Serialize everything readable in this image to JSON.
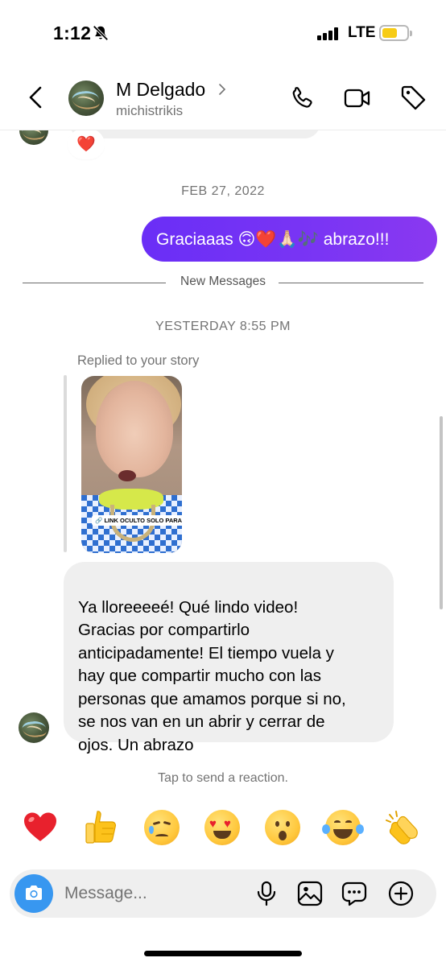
{
  "status_bar": {
    "time": "1:12",
    "network": "LTE",
    "battery_level": 0.62,
    "icons": [
      "bell-slash-icon",
      "signal-bars-icon",
      "battery-icon"
    ]
  },
  "header": {
    "name": "M Delgado",
    "username": "michistrikis",
    "icons": [
      "back-chevron-icon",
      "phone-icon",
      "video-camera-icon",
      "tag-icon"
    ]
  },
  "conversation": {
    "previous_reaction": "❤️",
    "date_separator": "FEB 27, 2022",
    "sent_message": "Graciaaas 🙃❤️🙏🏻🎶 abrazo!!!",
    "new_messages_label": "New Messages",
    "time_separator": "YESTERDAY 8:55 PM",
    "replied_label": "Replied to your story",
    "story_link_text": "LINK OCULTO SOLO PARA UDS",
    "received_message": "Ya lloreeeeé! Qué lindo video!\nGracias por compartirlo\nanticipadamente! El tiempo vuela y\nhay que compartir mucho con las\npersonas que amamos porque si no,\nse nos van en un abrir y cerrar de\nojos. Un abrazo"
  },
  "reactions": {
    "hint": "Tap to send a reaction.",
    "items": [
      {
        "name": "heart",
        "emoji": "❤️"
      },
      {
        "name": "thumbs-up",
        "emoji": "👍"
      },
      {
        "name": "crying",
        "emoji": "😢"
      },
      {
        "name": "heart-eyes",
        "emoji": "😍"
      },
      {
        "name": "surprised",
        "emoji": "😮"
      },
      {
        "name": "tears-of-joy",
        "emoji": "😂"
      },
      {
        "name": "clapping",
        "emoji": "👏"
      }
    ]
  },
  "composer": {
    "placeholder": "Message...",
    "icons": [
      "camera-icon",
      "microphone-icon",
      "gallery-icon",
      "sticker-icon",
      "add-icon"
    ]
  },
  "colors": {
    "sent_bubble": "#6a2ef6",
    "received_bubble": "#efefef",
    "camera_button": "#3897f0",
    "battery": "#f7cc16"
  }
}
